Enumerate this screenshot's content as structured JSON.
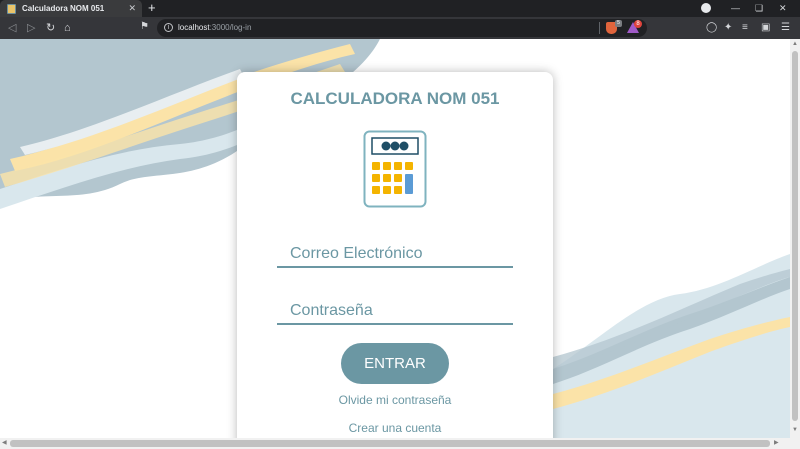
{
  "browser": {
    "tab_title": "Calculadora NOM 051",
    "tab_close": "✕",
    "new_tab": "+",
    "url_host": "localhost",
    "url_rest": ":3000/log-in",
    "brave_badge": "5",
    "rewards_badge": "8"
  },
  "icons": {
    "favicon": "calculator-favicon-icon",
    "back": "back-arrow-icon",
    "forward": "forward-arrow-icon",
    "reload": "reload-icon",
    "home": "home-icon",
    "bookmark": "bookmark-icon",
    "info": "info-icon",
    "calculator": "calculator-icon"
  },
  "login": {
    "title": "CALCULADORA NOM 051",
    "email_placeholder": "Correo Electrónico",
    "password_placeholder": "Contraseña",
    "submit_label": "ENTRAR",
    "forgot_label": "Olvide mi contraseña",
    "create_label": "Crear una cuenta"
  },
  "colors": {
    "accent": "#6b97a3",
    "wave_gray": "#b3c6cf",
    "wave_yellow": "#fbe3a8",
    "wave_light": "#d9e7ed"
  }
}
